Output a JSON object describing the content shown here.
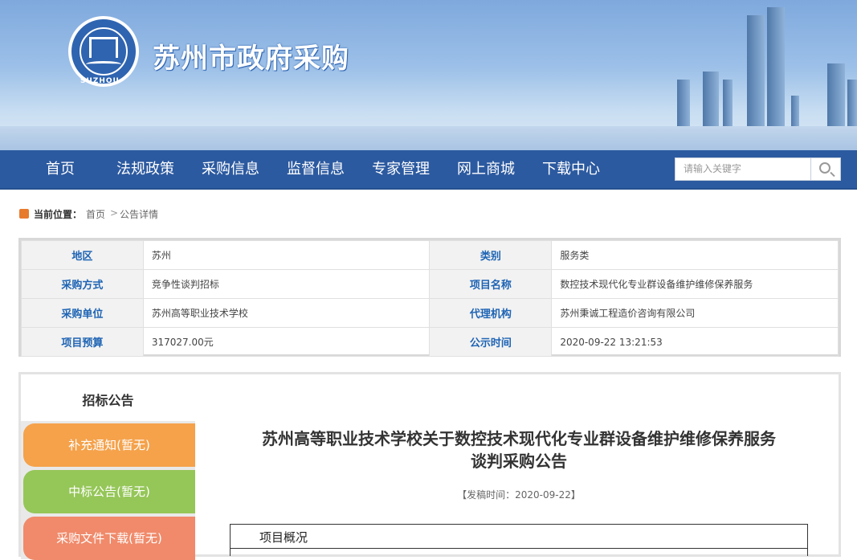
{
  "header": {
    "site_title": "苏州市政府采购",
    "logo_sub": "SUZHOU"
  },
  "nav": {
    "items": [
      "首页",
      "法规政策",
      "采购信息",
      "监督信息",
      "专家管理",
      "网上商城",
      "下载中心"
    ],
    "search_placeholder": "请输入关键字"
  },
  "breadcrumb": {
    "label": "当前位置：",
    "home": "首页",
    "separator": ">",
    "current": "公告详情"
  },
  "info": {
    "rows": [
      {
        "k1": "地区",
        "v1": "苏州",
        "k2": "类别",
        "v2": "服务类"
      },
      {
        "k1": "采购方式",
        "v1": "竞争性谈判招标",
        "k2": "项目名称",
        "v2": "数控技术现代化专业群设备维护维修保养服务"
      },
      {
        "k1": "采购单位",
        "v1": "苏州高等职业技术学校",
        "k2": "代理机构",
        "v2": "苏州秉诚工程造价咨询有限公司"
      },
      {
        "k1": "项目预算",
        "v1": "317027.00元",
        "k2": "公示时间",
        "v2": "2020-09-22 13:21:53"
      }
    ]
  },
  "sidebar": {
    "active_tab": "招标公告",
    "buttons": [
      {
        "label": "补充通知(暂无)",
        "color": "#f5a24b"
      },
      {
        "label": "中标公告(暂无)",
        "color": "#95c658"
      },
      {
        "label": "采购文件下载(暂无)",
        "color": "#f08a6a"
      }
    ]
  },
  "notice": {
    "title_line1": "苏州高等职业技术学校关于数控技术现代化专业群设备维护维修保养服务",
    "title_line2": "谈判采购公告",
    "publish_time": "【发稿时间：2020-09-22】",
    "section_heading": "项目概况"
  },
  "colors": {
    "nav_bg": "#2c5aa0",
    "label_blue": "#1e64b4"
  }
}
